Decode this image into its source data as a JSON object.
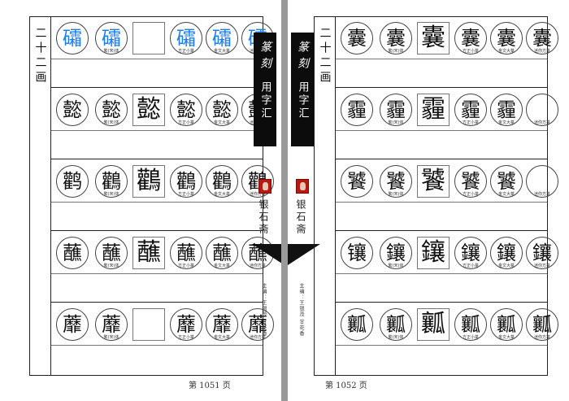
{
  "book": {
    "title": "篆刻用字汇",
    "series_title": "用字汇",
    "seal_title": "篆刻",
    "publisher": "银石斋",
    "editors": "主编：王银茂 甘花香"
  },
  "labels": [
    "繁(宋)体",
    "方正小篆",
    "金文大篆",
    "迷你方篆"
  ],
  "left_page": {
    "section": "二十二画",
    "page_number": "第 1051 页",
    "entries": [
      {
        "char": "礵",
        "variants": [
          "礵",
          "",
          "礵",
          "礵",
          "礵"
        ],
        "blue": true
      },
      {
        "char": "懿",
        "variants": [
          "懿",
          "懿",
          "懿",
          "懿",
          "懿"
        ],
        "blue": false
      },
      {
        "char": "鹳",
        "variants": [
          "鸛",
          "鸛",
          "鸛",
          "鸛",
          "鸛"
        ],
        "blue": false
      },
      {
        "char": "蘸",
        "variants": [
          "蘸",
          "蘸",
          "蘸",
          "蘸",
          "蘸"
        ],
        "blue": false
      },
      {
        "char": "蘼",
        "variants": [
          "蘼",
          "",
          "蘼",
          "蘼",
          "蘼"
        ],
        "blue": false
      }
    ]
  },
  "right_page": {
    "section": "二十二画",
    "page_number": "第 1052 页",
    "entries": [
      {
        "char": "囊",
        "variants": [
          "囊",
          "囊",
          "囊",
          "囊",
          "囊"
        ]
      },
      {
        "char": "霾",
        "variants": [
          "霾",
          "霾",
          "霾",
          "霾",
          ""
        ]
      },
      {
        "char": "饕",
        "variants": [
          "饕",
          "饕",
          "饕",
          "饕",
          ""
        ]
      },
      {
        "char": "镶",
        "variants": [
          "鑲",
          "鑲",
          "鑲",
          "鑲",
          "鑲"
        ]
      },
      {
        "char": "瓤",
        "variants": [
          "瓤",
          "瓤",
          "瓤",
          "瓤",
          "瓤"
        ]
      }
    ]
  }
}
